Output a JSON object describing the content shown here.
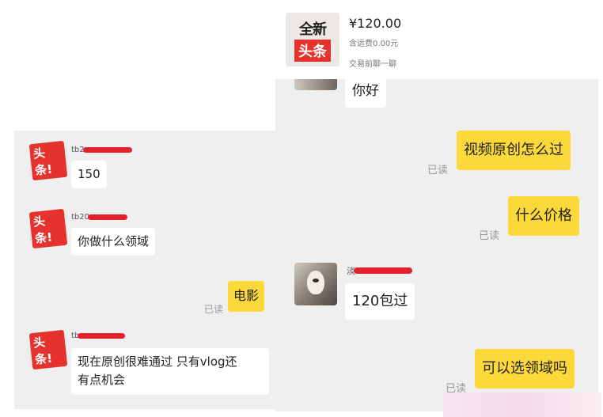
{
  "left_chat": {
    "messages": [
      {
        "sender_prefix": "tb2",
        "text": "150"
      },
      {
        "sender_prefix": "tb20",
        "text": "你做什么领域"
      },
      {
        "text": "电影",
        "read": "已读"
      },
      {
        "sender_prefix": "tb",
        "text_line1": "现在原创很难通过 只有vlog还",
        "text_line2": "有点机会"
      }
    ],
    "avatar_logo": "头条!"
  },
  "product": {
    "thumb_top": "全新",
    "thumb_bottom": "头条",
    "price": "¥120.00",
    "shipping": "含运费0.00元",
    "chat_link": "交易前聊一聊"
  },
  "right_chat": {
    "messages": [
      {
        "text": "你好"
      },
      {
        "text": "视频原创怎么过",
        "read": "已读"
      },
      {
        "text": "什么价格",
        "read": "已读"
      },
      {
        "sender_prefix": "淡",
        "text": "120包过"
      },
      {
        "text": "可以选领域吗",
        "read": "已读"
      }
    ]
  },
  "colors": {
    "self_bubble": "#fcd83a",
    "other_bubble": "#ffffff",
    "background": "#efefef",
    "redaction": "#e2232b",
    "logo_red": "#e5322d"
  }
}
